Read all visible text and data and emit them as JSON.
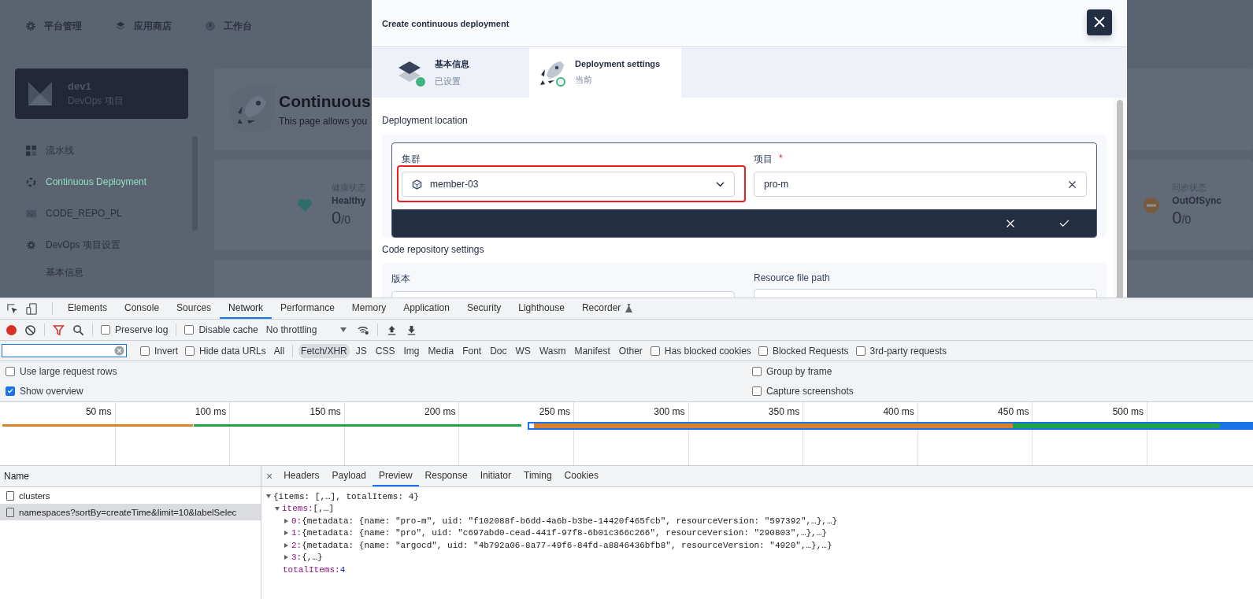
{
  "top_nav": [
    "平台管理",
    "应用商店",
    "工作台"
  ],
  "project_card": {
    "name": "dev1",
    "type": "DevOps 项目"
  },
  "sidebar": {
    "items": [
      {
        "label": "流水线",
        "selected": false
      },
      {
        "label": "Continuous Deployment",
        "selected": true
      },
      {
        "label": "CODE_REPO_PL",
        "selected": false
      },
      {
        "label": "DevOps 项目设置",
        "selected": false,
        "children": [
          {
            "label": "基本信息",
            "selected": false
          }
        ]
      }
    ]
  },
  "page_header": {
    "title": "Continuous",
    "subtitle": "This page allows you"
  },
  "status_cards": [
    {
      "label": "健康状态",
      "status": "Healthy",
      "value": "0",
      "total": "/0",
      "kind": "healthy"
    },
    {
      "label": "同步状态",
      "status": "OutOfSync",
      "value": "0",
      "total": "/0",
      "kind": "outofsync"
    }
  ],
  "dialog": {
    "title": "Create continuous deployment",
    "steps": [
      {
        "title": "基本信息",
        "status": "已设置",
        "selected": false,
        "done": true
      },
      {
        "title": "Deployment settings",
        "status": "当前",
        "selected": true,
        "done": false
      }
    ],
    "location": {
      "heading": "Deployment location",
      "cluster": {
        "label": "集群",
        "value": "member-03",
        "highlighted": true
      },
      "project": {
        "label": "项目",
        "required_mark": "*",
        "value": "pro-m"
      }
    },
    "repository": {
      "heading": "Code repository settings",
      "fields": [
        {
          "label": "版本"
        },
        {
          "label": "Resource file path"
        }
      ]
    }
  },
  "devtools": {
    "tabs": [
      {
        "label": "Elements",
        "selected": false
      },
      {
        "label": "Console",
        "selected": false
      },
      {
        "label": "Sources",
        "selected": false
      },
      {
        "label": "Network",
        "selected": true
      },
      {
        "label": "Performance",
        "selected": false
      },
      {
        "label": "Memory",
        "selected": false
      },
      {
        "label": "Application",
        "selected": false
      },
      {
        "label": "Security",
        "selected": false
      },
      {
        "label": "Lighthouse",
        "selected": false
      },
      {
        "label": "Recorder",
        "selected": false
      }
    ],
    "toolbar": {
      "recording": true,
      "checkboxes": [
        {
          "label": "Preserve log",
          "checked": false
        },
        {
          "label": "Disable cache",
          "checked": false
        }
      ],
      "throttling": "No throttling"
    },
    "filter": {
      "checkboxes": [
        {
          "label": "Invert",
          "checked": false
        },
        {
          "label": "Hide data URLs",
          "checked": false
        }
      ],
      "types": [
        {
          "label": "All",
          "selected": false
        },
        {
          "label": "Fetch/XHR",
          "selected": true
        },
        {
          "label": "JS",
          "selected": false
        },
        {
          "label": "CSS",
          "selected": false
        },
        {
          "label": "Img",
          "selected": false
        },
        {
          "label": "Media",
          "selected": false
        },
        {
          "label": "Font",
          "selected": false
        },
        {
          "label": "Doc",
          "selected": false
        },
        {
          "label": "WS",
          "selected": false
        },
        {
          "label": "Wasm",
          "selected": false
        },
        {
          "label": "Manifest",
          "selected": false
        },
        {
          "label": "Other",
          "selected": false
        }
      ],
      "more": [
        {
          "label": "Has blocked cookies",
          "checked": false
        },
        {
          "label": "Blocked Requests",
          "checked": false
        },
        {
          "label": "3rd-party requests",
          "checked": false
        }
      ]
    },
    "options": [
      {
        "label": "Use large request rows",
        "checked": false
      },
      {
        "label": "Group by frame",
        "checked": false
      },
      {
        "label": "Show overview",
        "checked": true
      },
      {
        "label": "Capture screenshots",
        "checked": false
      }
    ],
    "overview": {
      "ticks": [
        "50 ms",
        "100 ms",
        "150 ms",
        "200 ms",
        "250 ms",
        "300 ms",
        "350 ms",
        "400 ms",
        "450 ms",
        "500 ms"
      ]
    },
    "requests": {
      "header": "Name",
      "rows": [
        {
          "name": "clusters",
          "selected": false
        },
        {
          "name": "namespaces?sortBy=createTime&limit=10&labelSelec",
          "selected": true
        }
      ]
    },
    "details": {
      "close": "×",
      "tabs": [
        {
          "label": "Headers",
          "selected": false
        },
        {
          "label": "Payload",
          "selected": false
        },
        {
          "label": "Preview",
          "selected": true
        },
        {
          "label": "Response",
          "selected": false
        },
        {
          "label": "Initiator",
          "selected": false
        },
        {
          "label": "Timing",
          "selected": false
        },
        {
          "label": "Cookies",
          "selected": false
        }
      ],
      "preview": [
        {
          "kind": "object",
          "value": "{items: [,…], totalItems: 4}",
          "expanded": true,
          "children": [
            {
              "kind": "object",
              "key": "items:",
              "value": "[,…]",
              "expanded": true,
              "children": [
                {
                  "kind": "object",
                  "key": "0:",
                  "value": "{metadata: {name: \"pro-m\", uid: \"f102088f-b6dd-4a6b-b3be-14420f465fcb\", resourceVersion: \"597392\",…},…}",
                  "expanded": false
                },
                {
                  "kind": "object",
                  "key": "1:",
                  "value": "{metadata: {name: \"pro\", uid: \"c697abd0-cead-441f-97f8-6b01c366c266\", resourceVersion: \"290803\",…},…}",
                  "expanded": false
                },
                {
                  "kind": "object",
                  "key": "2:",
                  "value": "{metadata: {name: \"argocd\", uid: \"4b792a06-8a77-49f6-84fd-a8846436bfb8\", resourceVersion: \"4920\",…},…}",
                  "expanded": false
                },
                {
                  "kind": "object",
                  "key": "3:",
                  "value": "{,…}",
                  "expanded": false
                }
              ]
            },
            {
              "kind": "number",
              "key": "totalItems:",
              "value": "4"
            }
          ]
        }
      ]
    }
  }
}
